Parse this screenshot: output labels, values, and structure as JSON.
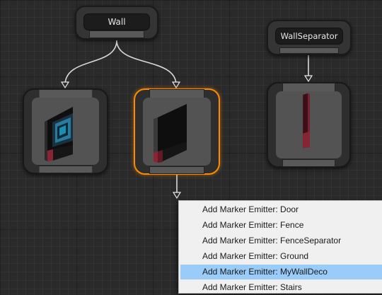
{
  "graph": {
    "wall_node": {
      "label": "Wall"
    },
    "separator_node": {
      "label": "WallSeparator"
    },
    "visual_nodes": [
      {
        "name": "wall-with-window-mesh",
        "selected": false
      },
      {
        "name": "wall-mesh",
        "selected": true
      },
      {
        "name": "wall-separator-pillar-mesh",
        "selected": false
      }
    ]
  },
  "context_menu": {
    "items": [
      {
        "label": "Add Marker Emitter: Door",
        "highlighted": false
      },
      {
        "label": "Add Marker Emitter: Fence",
        "highlighted": false
      },
      {
        "label": "Add Marker Emitter: FenceSeparator",
        "highlighted": false
      },
      {
        "label": "Add Marker Emitter: Ground",
        "highlighted": false
      },
      {
        "label": "Add Marker Emitter: MyWallDeco",
        "highlighted": true
      },
      {
        "label": "Add Marker Emitter: Stairs",
        "highlighted": false
      }
    ]
  },
  "colors": {
    "canvas_background": "#2a2a2a",
    "selection_outline": "#ff8a00",
    "menu_highlight": "#99ccf8",
    "link_color": "#d9d9d9"
  }
}
